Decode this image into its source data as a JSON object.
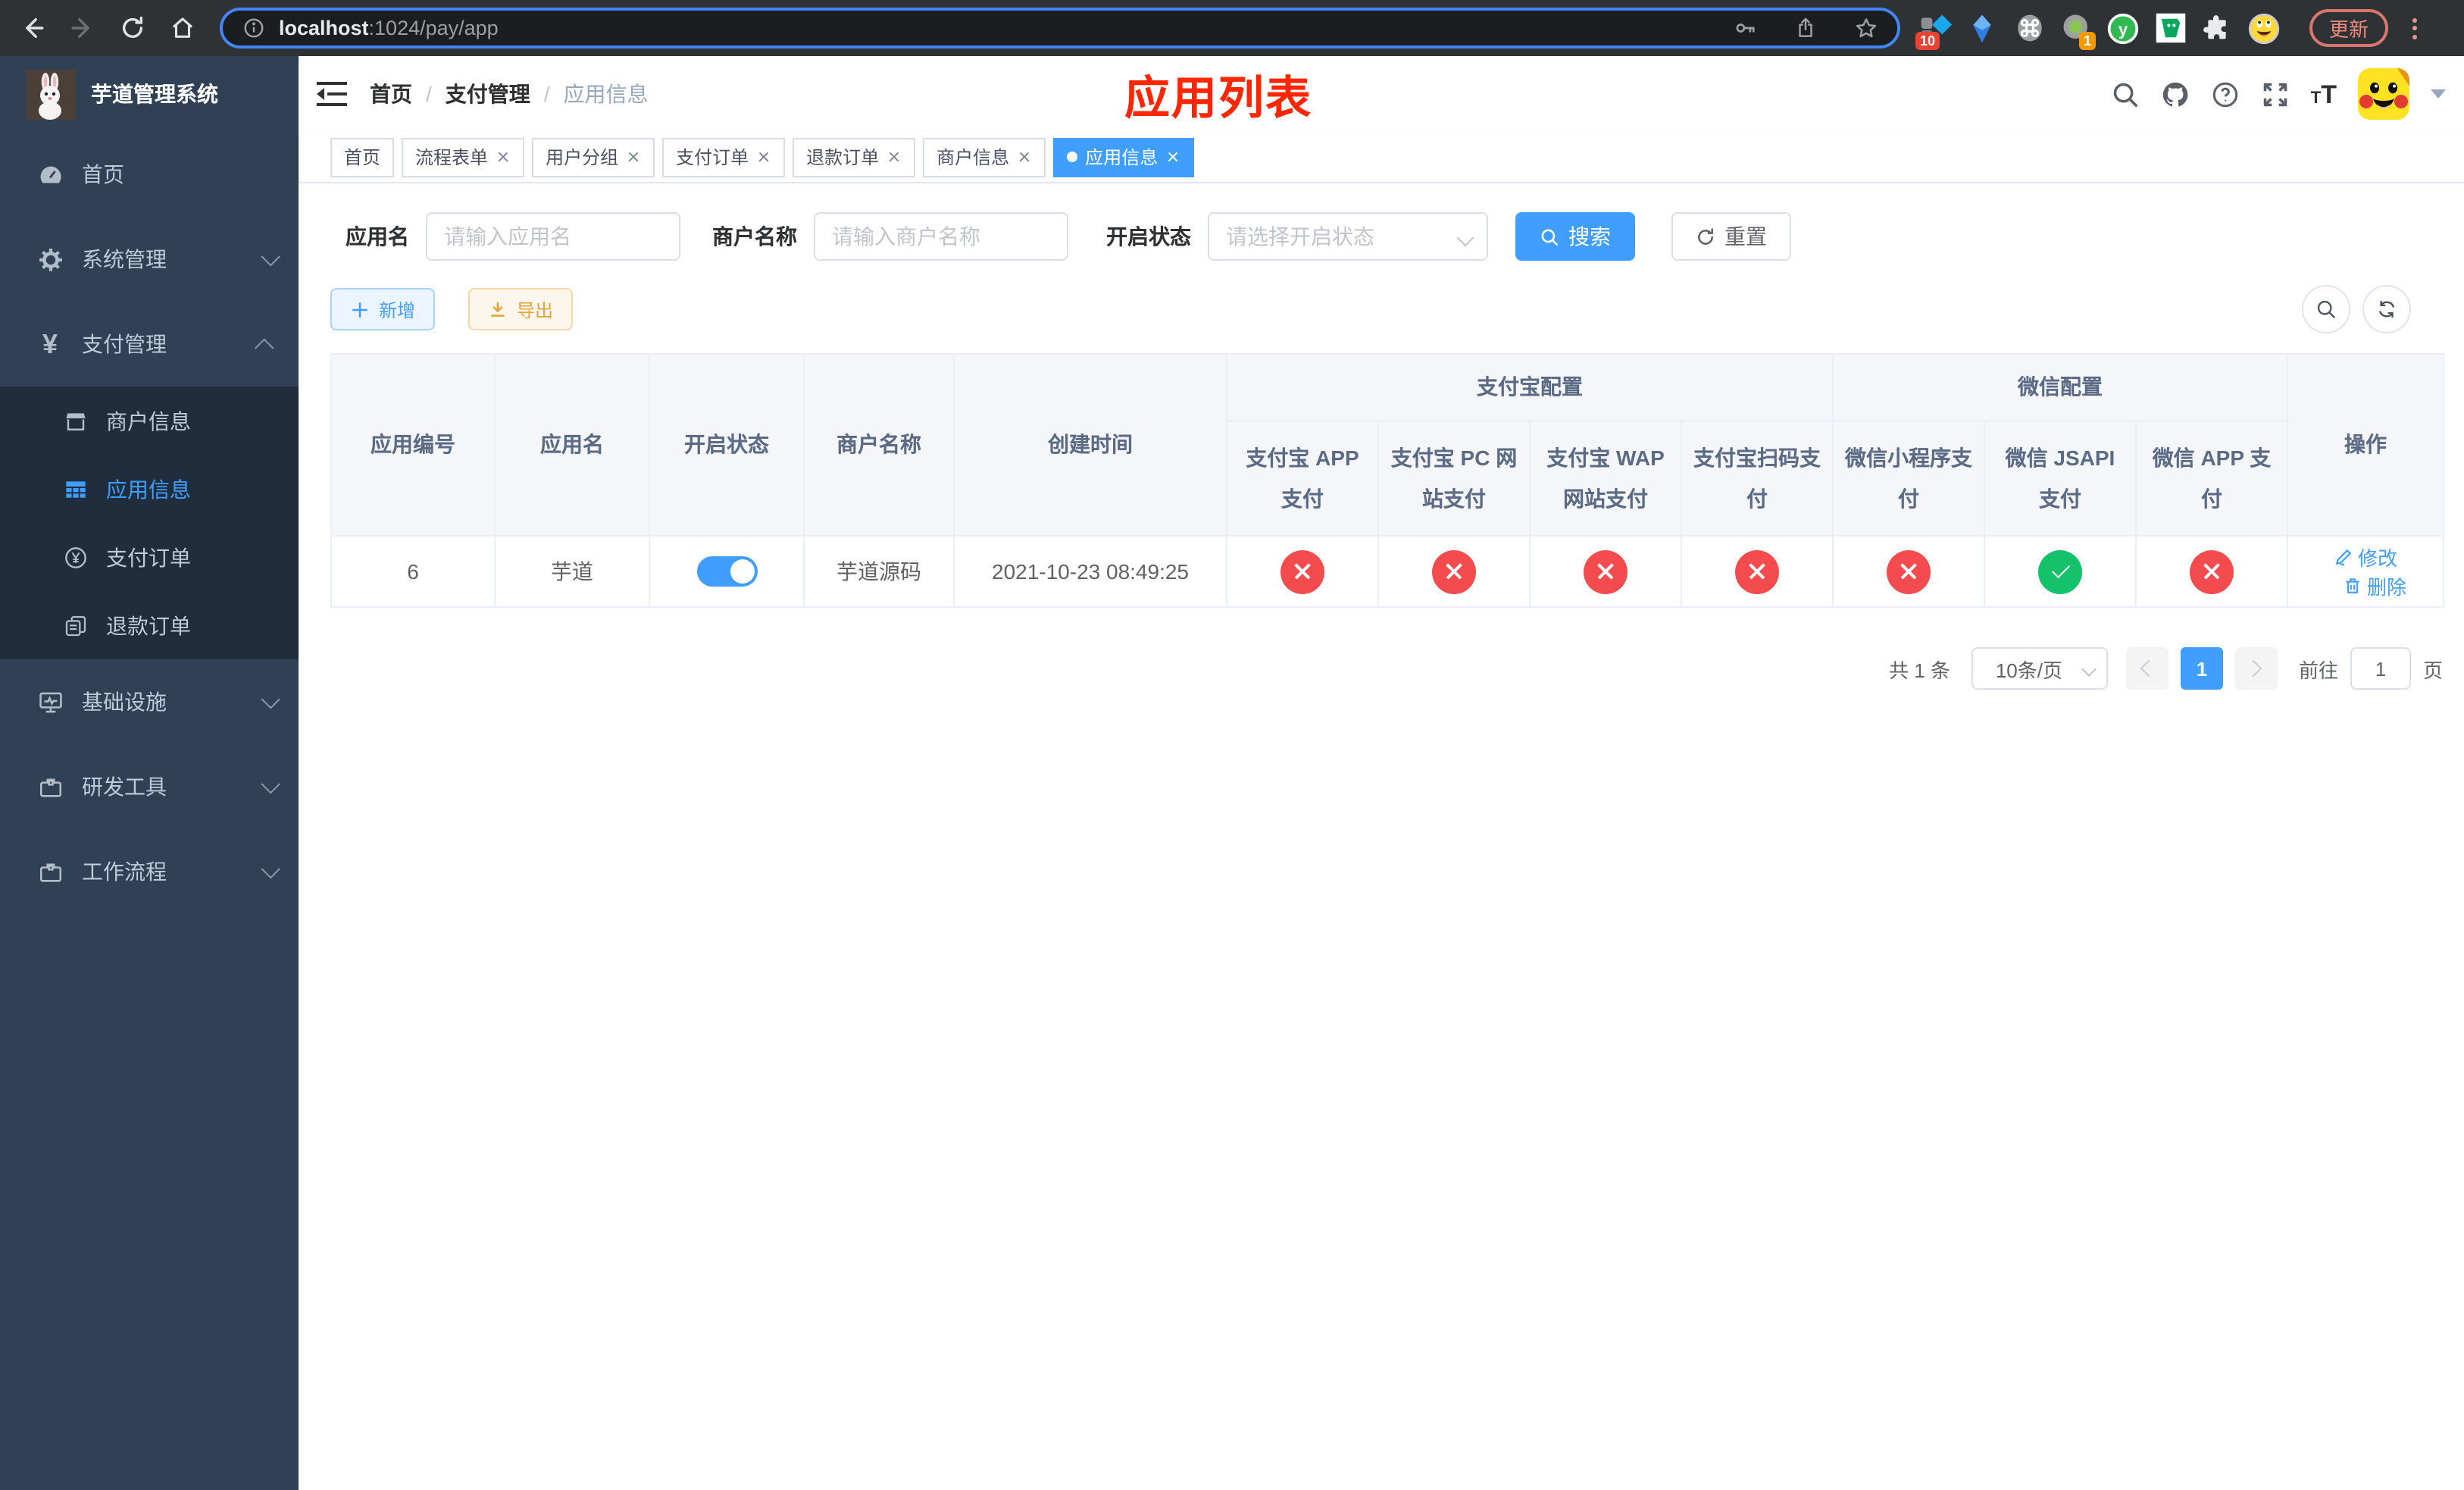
{
  "browser": {
    "url_host": "localhost",
    "url_path": ":1024/pay/app",
    "ext_badge_blue": "10",
    "ext_badge_gray": "1",
    "update_label": "更新"
  },
  "sidebar": {
    "title": "芋道管理系统",
    "items": [
      {
        "label": "首页",
        "icon": "dashboard-icon"
      },
      {
        "label": "系统管理",
        "icon": "gear-icon",
        "chevron": "down"
      },
      {
        "label": "支付管理",
        "icon": "yen-icon",
        "chevron": "up",
        "expanded": true,
        "children": [
          {
            "label": "商户信息",
            "icon": "store-icon",
            "active": false
          },
          {
            "label": "应用信息",
            "icon": "grid-icon",
            "active": true
          },
          {
            "label": "支付订单",
            "icon": "yen-circle-icon",
            "active": false
          },
          {
            "label": "退款订单",
            "icon": "document-icon",
            "active": false
          }
        ]
      },
      {
        "label": "基础设施",
        "icon": "monitor-icon",
        "chevron": "down"
      },
      {
        "label": "研发工具",
        "icon": "toolbox-icon",
        "chevron": "down"
      },
      {
        "label": "工作流程",
        "icon": "toolbox-icon",
        "chevron": "down"
      }
    ]
  },
  "header": {
    "breadcrumb": [
      "首页",
      "支付管理",
      "应用信息"
    ],
    "separator": "/",
    "page_title": "应用列表"
  },
  "tabs": [
    {
      "label": "首页",
      "closable": false,
      "active": false
    },
    {
      "label": "流程表单",
      "closable": true,
      "active": false
    },
    {
      "label": "用户分组",
      "closable": true,
      "active": false
    },
    {
      "label": "支付订单",
      "closable": true,
      "active": false
    },
    {
      "label": "退款订单",
      "closable": true,
      "active": false
    },
    {
      "label": "商户信息",
      "closable": true,
      "active": false
    },
    {
      "label": "应用信息",
      "closable": true,
      "active": true
    }
  ],
  "filters": {
    "app_name_label": "应用名",
    "app_name_placeholder": "请输入应用名",
    "merchant_label": "商户名称",
    "merchant_placeholder": "请输入商户名称",
    "status_label": "开启状态",
    "status_placeholder": "请选择开启状态",
    "search_label": "搜索",
    "reset_label": "重置"
  },
  "toolbar": {
    "add_label": "新增",
    "export_label": "导出"
  },
  "table": {
    "headers": {
      "app_id": "应用编号",
      "app_name": "应用名",
      "status": "开启状态",
      "merchant": "商户名称",
      "created": "创建时间",
      "alipay_group": "支付宝配置",
      "wechat_group": "微信配置",
      "actions": "操作",
      "alipay_app": "支付宝 APP 支付",
      "alipay_pc": "支付宝 PC 网站支付",
      "alipay_wap": "支付宝 WAP 网站支付",
      "alipay_qr": "支付宝扫码支付",
      "wx_mini": "微信小程序支付",
      "wx_jsapi": "微信 JSAPI 支付",
      "wx_app": "微信 APP 支付"
    },
    "rows": [
      {
        "app_id": "6",
        "app_name": "芋道",
        "status_on": true,
        "merchant": "芋道源码",
        "created": "2021-10-23 08:49:25",
        "configs": {
          "alipay_app": "disabled",
          "alipay_pc": "disabled",
          "alipay_wap": "disabled",
          "alipay_qr": "disabled",
          "wx_mini": "disabled",
          "wx_jsapi": "enabled",
          "wx_app": "disabled"
        },
        "edit_label": "修改",
        "delete_label": "删除"
      }
    ]
  },
  "pagination": {
    "total": "共 1 条",
    "page_size": "10条/页",
    "current_page": "1",
    "goto_label": "前往",
    "goto_value": "1",
    "goto_unit": "页"
  }
}
